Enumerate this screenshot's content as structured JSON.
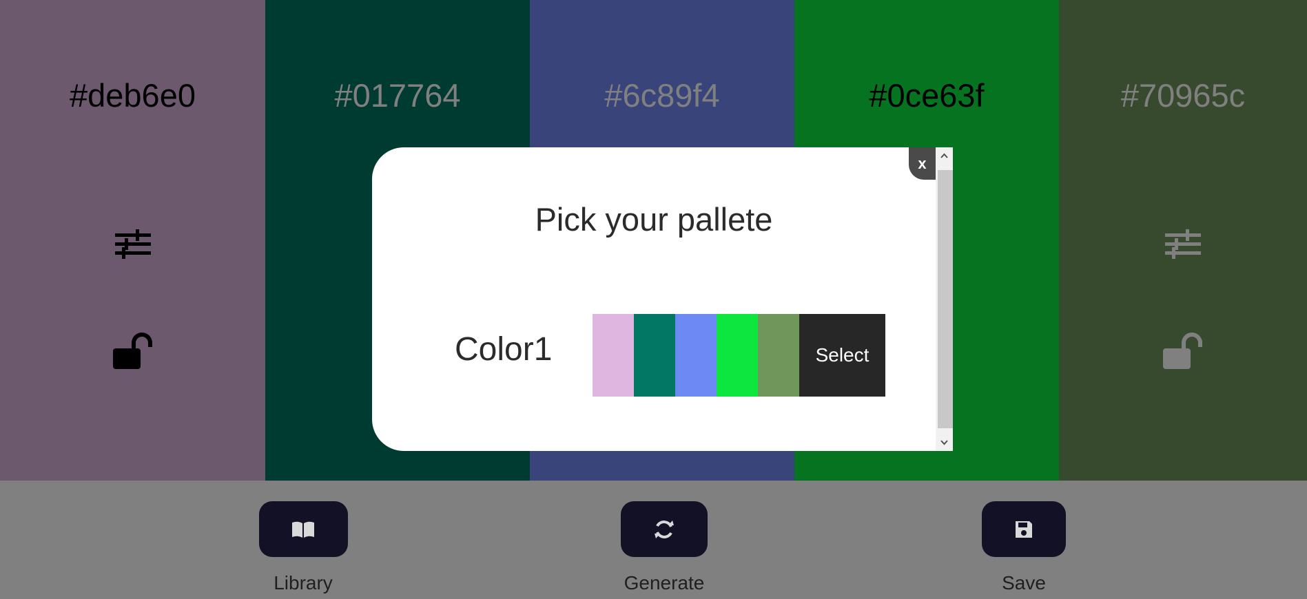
{
  "palette_columns": [
    {
      "hex": "#deb6e0",
      "background": "#6d596e",
      "text_color": "#000000"
    },
    {
      "hex": "#017764",
      "background": "#003b32",
      "text_color": "#808080"
    },
    {
      "hex": "#6c89f4",
      "background": "#39457a",
      "text_color": "#808080"
    },
    {
      "hex": "#0ce63f",
      "background": "#067321",
      "text_color": "#000000"
    },
    {
      "hex": "#70965c",
      "background": "#384a2e",
      "text_color": "#808080"
    }
  ],
  "icons": {
    "adjust": "sliders-icon",
    "lock": "unlocked-padlock-icon"
  },
  "controls": {
    "library": {
      "label": "Library",
      "icon": "book-icon"
    },
    "generate": {
      "label": "Generate",
      "icon": "refresh-icon"
    },
    "save": {
      "label": "Save",
      "icon": "floppy-disk-icon"
    }
  },
  "modal": {
    "title": "Pick your pallete",
    "close_label": "x",
    "palettes": [
      {
        "name": "Color1",
        "swatches": [
          "#deb6e0",
          "#017764",
          "#6c89f4",
          "#0ce63f",
          "#70965c"
        ],
        "select_label": "Select"
      }
    ]
  },
  "colors": {
    "panel": "#808080",
    "button_bg": "#131125",
    "modal_bg": "#ffffff",
    "select_bg": "#272727"
  }
}
